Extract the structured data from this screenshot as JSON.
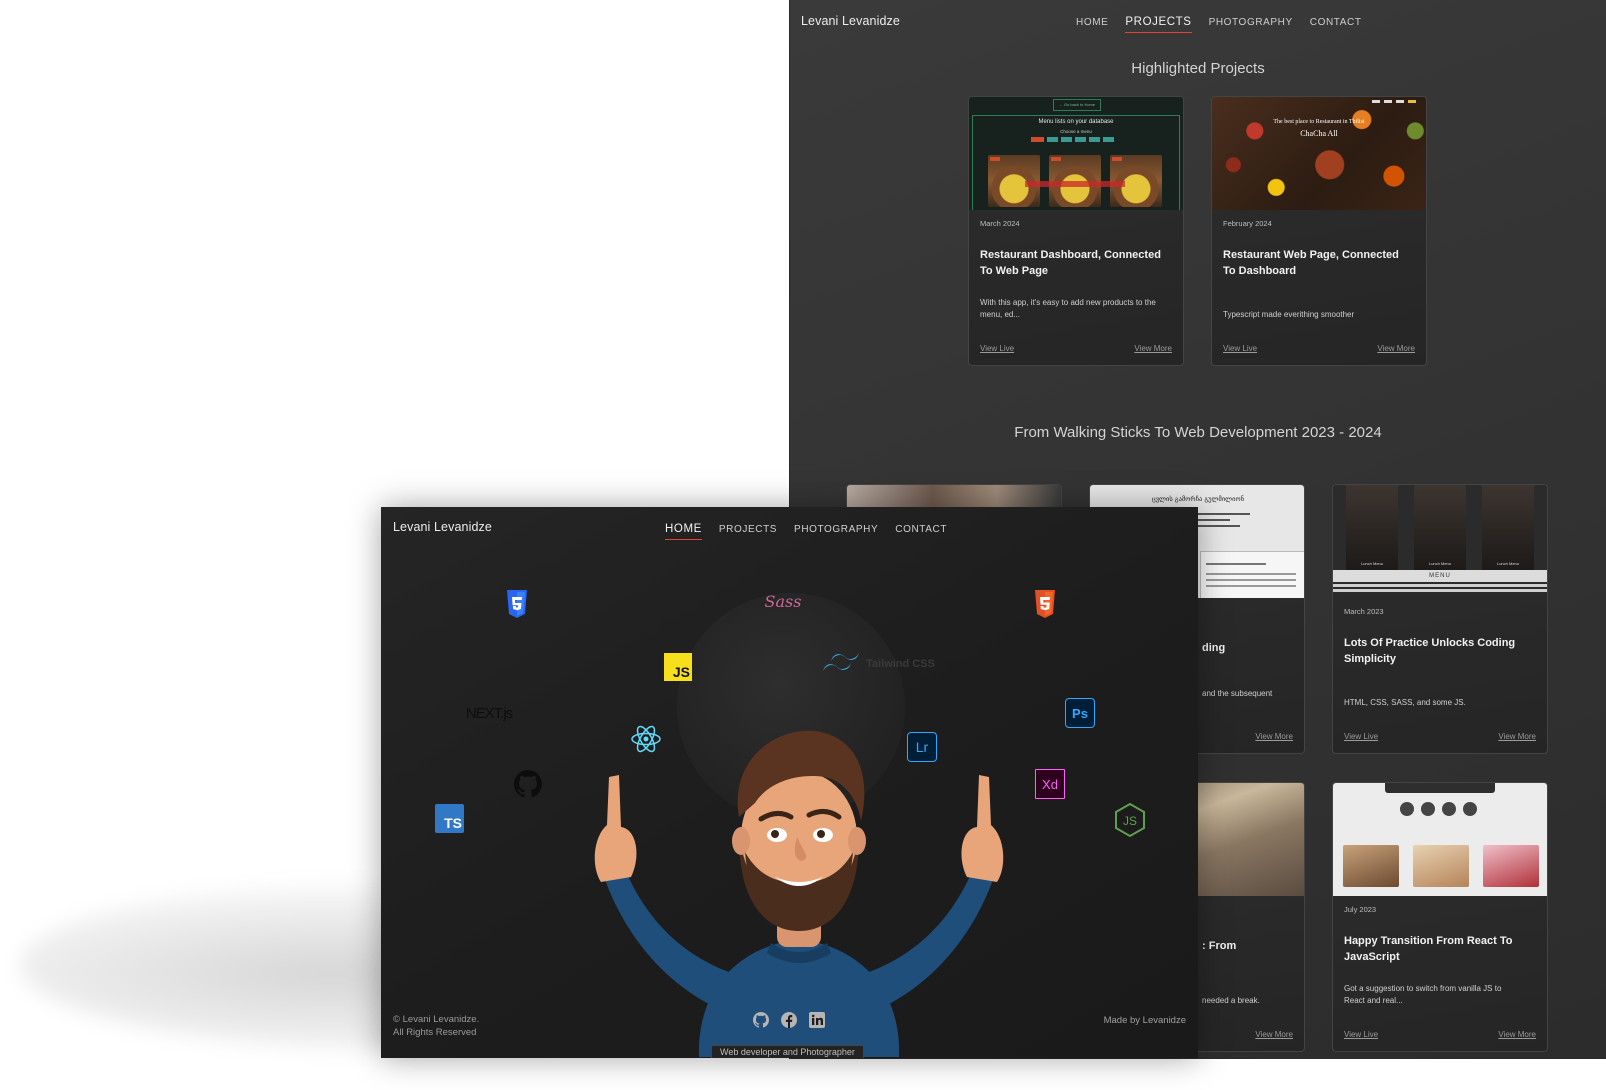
{
  "projects_page": {
    "brand": "Levani Levanidze",
    "nav": [
      {
        "label": "HOME",
        "active": false
      },
      {
        "label": "PROJECTS",
        "active": true
      },
      {
        "label": "PHOTOGRAPHY",
        "active": false
      },
      {
        "label": "CONTACT",
        "active": false
      }
    ],
    "highlighted_title": "Highlighted Projects",
    "highlighted": [
      {
        "date": "March 2024",
        "title": "Restaurant Dashboard, Connected To Web Page",
        "desc": "With this app, it's easy to add new products to the menu, ed...",
        "view_live": "View Live",
        "view_more": "View More",
        "thumb": {
          "heading": "Menu lists on your database",
          "sub": "Choose a menu",
          "button": "← Go back to Home"
        }
      },
      {
        "date": "February 2024",
        "title": "Restaurant Web Page, Connected To Dashboard",
        "desc": "Typescript made everithing smoother",
        "view_live": "View Live",
        "view_more": "View More",
        "thumb": {
          "caption": "The best place to Restaurant in Tbilisi",
          "name": "ChaCha All"
        }
      }
    ],
    "timeline_title": "From Walking Sticks To Web Development 2023 - 2024",
    "timeline": [
      {
        "title_fragment": "ding",
        "desc_fragment": "and the subsequent",
        "view_more": "View More",
        "thumb_text": "ცვლის გამორჩა გულმილიონ"
      },
      {
        "date": "March 2023",
        "title": "Lots Of Practice Unlocks Coding Simplicity",
        "desc": "HTML, CSS, SASS, and some JS.",
        "view_live": "View Live",
        "view_more": "View More",
        "thumb": {
          "menu_label": "MENU",
          "items": [
            "Lunch Menu",
            "Lunch Menu",
            "Lunch Menu"
          ]
        }
      },
      {
        "title_fragment": ": From",
        "desc_fragment": "needed a break.",
        "view_more": "View More"
      },
      {
        "date": "July 2023",
        "title": "Happy Transition From React To JavaScript",
        "desc": "Got a suggestion to switch from vanilla JS to React and real...",
        "view_live": "View Live",
        "view_more": "View More"
      }
    ]
  },
  "home_page": {
    "brand": "Levani Levanidze",
    "nav": [
      {
        "label": "HOME",
        "active": true
      },
      {
        "label": "PROJECTS",
        "active": false
      },
      {
        "label": "PHOTOGRAPHY",
        "active": false
      },
      {
        "label": "CONTACT",
        "active": false
      }
    ],
    "tech_icons": [
      {
        "name": "css3-icon",
        "label": ""
      },
      {
        "name": "sass-icon",
        "label": "Sass"
      },
      {
        "name": "html5-icon",
        "label": ""
      },
      {
        "name": "javascript-icon",
        "label": "JS"
      },
      {
        "name": "tailwind-icon",
        "label": "Tailwind CSS"
      },
      {
        "name": "nextjs-icon",
        "label": "NEXT.js"
      },
      {
        "name": "photoshop-icon",
        "label": "Ps"
      },
      {
        "name": "react-icon",
        "label": ""
      },
      {
        "name": "lightroom-icon",
        "label": "Lr"
      },
      {
        "name": "github-icon",
        "label": ""
      },
      {
        "name": "xd-icon",
        "label": "Xd"
      },
      {
        "name": "typescript-icon",
        "label": "TS"
      },
      {
        "name": "nodejs-icon",
        "label": "JS"
      }
    ],
    "footer": {
      "copyright_line1": "© Levani Levanidze.",
      "copyright_line2": "All Rights Reserved",
      "made_by": "Made by Levanidze",
      "tooltip": "Web developer and Photographer",
      "socials": [
        "github-icon",
        "facebook-icon",
        "linkedin-icon"
      ]
    }
  },
  "colors": {
    "accent_underline": "#e2452f",
    "back_bg": "#343434",
    "front_bg": "#1d1d1d",
    "css3": "#2965f1",
    "html5": "#e34f26",
    "js": "#f7df1e",
    "ts": "#3178c6",
    "react": "#61dafb",
    "tailwind": "#38bdf8",
    "ps": "#31a8ff",
    "lr": "#31a8ff",
    "xd": "#ff61f6",
    "node": "#5fa04e",
    "sass": "#cc6699"
  }
}
